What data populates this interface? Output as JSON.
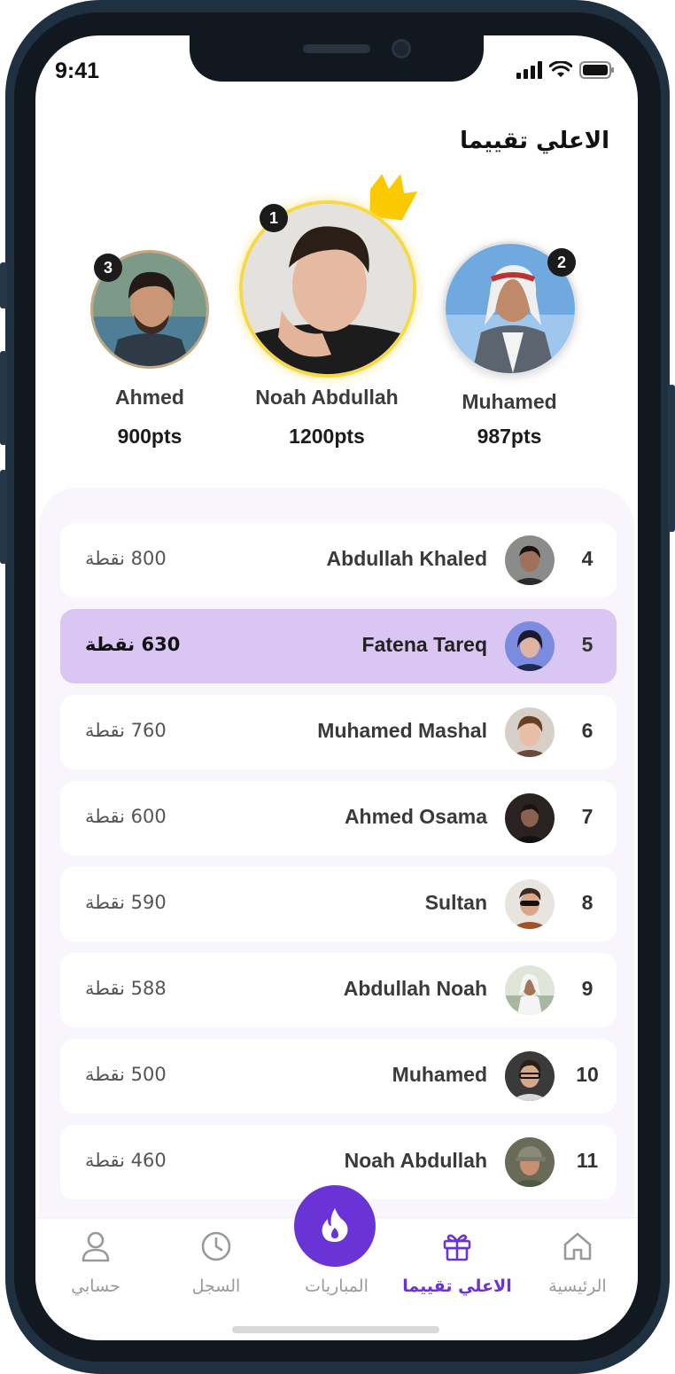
{
  "status_bar": {
    "time": "9:41"
  },
  "page_title": "الاعلي تقييما",
  "podium": [
    {
      "rank": "1",
      "name": "Noah Abdullah",
      "points": "1200pts"
    },
    {
      "rank": "2",
      "name": "Muhamed",
      "points": "987pts"
    },
    {
      "rank": "3",
      "name": "Ahmed",
      "points": "900pts"
    }
  ],
  "leaderboard": [
    {
      "rank": "4",
      "name": "Abdullah Khaled",
      "points": "800 نقطة"
    },
    {
      "rank": "5",
      "name": "Fatena Tareq",
      "points": "630 نقطة"
    },
    {
      "rank": "6",
      "name": "Muhamed Mashal",
      "points": "760 نقطة"
    },
    {
      "rank": "7",
      "name": "Ahmed Osama",
      "points": "600 نقطة"
    },
    {
      "rank": "8",
      "name": "Sultan",
      "points": "590 نقطة"
    },
    {
      "rank": "9",
      "name": "Abdullah Noah",
      "points": "588 نقطة"
    },
    {
      "rank": "10",
      "name": "Muhamed",
      "points": "500 نقطة"
    },
    {
      "rank": "11",
      "name": "Noah Abdullah",
      "points": "460 نقطة"
    }
  ],
  "tabs": {
    "home": "الرئيسية",
    "top_rated": "الاعلي تقييما",
    "matches": "المباريات",
    "history": "السجل",
    "account": "حسابي"
  },
  "colors": {
    "accent": "#6a33d6",
    "highlight_row": "#d9c6f2",
    "crown": "#fbc900"
  }
}
